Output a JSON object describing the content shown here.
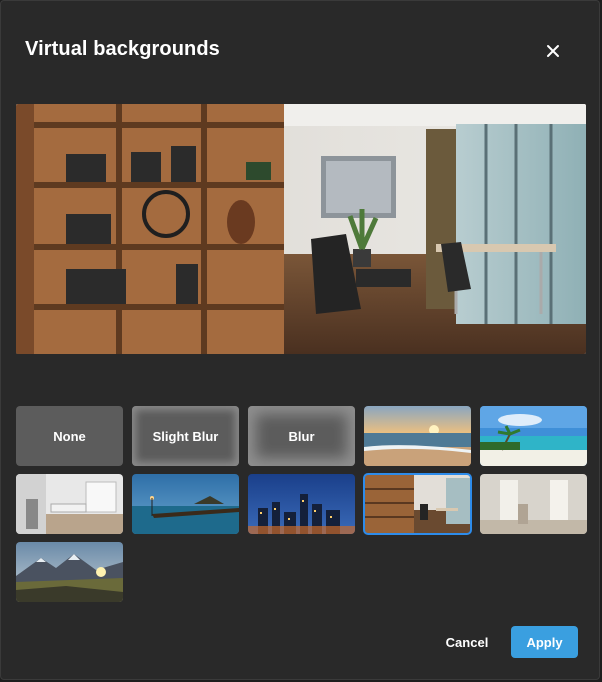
{
  "dialog": {
    "title": "Virtual backgrounds",
    "close_icon": "close-icon"
  },
  "preview": {
    "image": "office-interior-photo"
  },
  "backgrounds": [
    {
      "id": "none",
      "label": "None"
    },
    {
      "id": "slight-blur",
      "label": "Slight Blur"
    },
    {
      "id": "blur",
      "label": "Blur"
    },
    {
      "id": "sunset-beach",
      "image": "sunset-beach-photo"
    },
    {
      "id": "tropical-beach",
      "image": "tropical-beach-photo"
    },
    {
      "id": "white-kitchen",
      "image": "white-kitchen-photo"
    },
    {
      "id": "pier-dusk",
      "image": "pier-dusk-photo"
    },
    {
      "id": "city-night",
      "image": "city-night-photo"
    },
    {
      "id": "office",
      "image": "office-interior-photo",
      "selected": true
    },
    {
      "id": "bright-room",
      "image": "bright-room-blurred-photo"
    },
    {
      "id": "mountain-sunrise",
      "image": "mountain-sunrise-photo"
    }
  ],
  "actions": {
    "cancel_label": "Cancel",
    "apply_label": "Apply"
  },
  "colors": {
    "dialog_bg": "#292929",
    "accent": "#3a9fe0",
    "selected_outline": "#2d8ceb"
  }
}
